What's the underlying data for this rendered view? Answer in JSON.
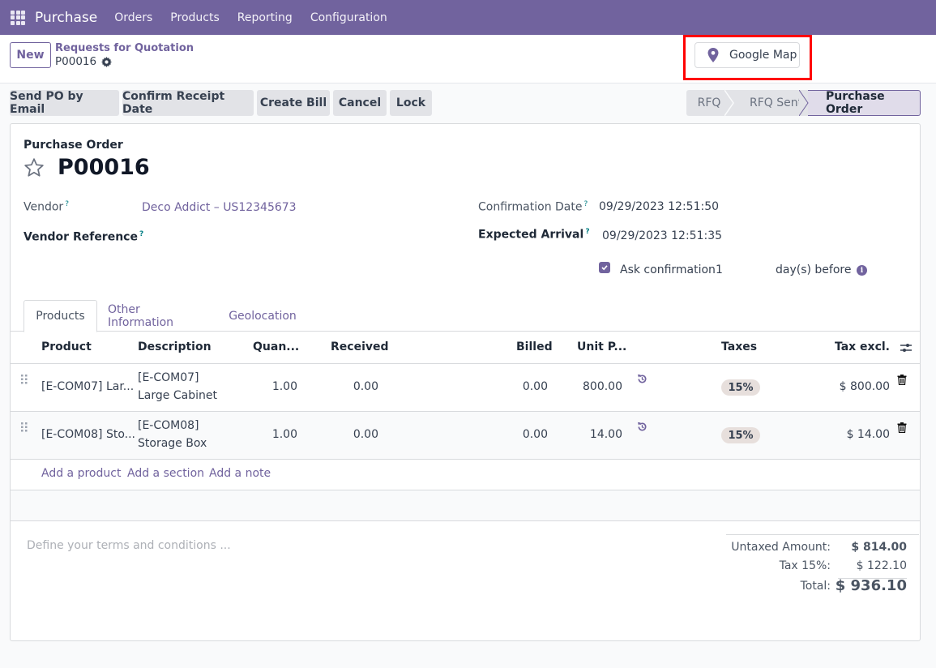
{
  "navbar": {
    "app_name": "Purchase",
    "menu": [
      "Orders",
      "Products",
      "Reporting",
      "Configuration"
    ],
    "apps_icon": "grid-icon"
  },
  "control_panel": {
    "new_label": "New",
    "breadcrumb_parent": "Requests for Quotation",
    "breadcrumb_current": "P00016",
    "settings_icon": "gear-icon",
    "map_button": {
      "label": "Google Map",
      "icon": "map-pin-icon"
    }
  },
  "actions": [
    "Send PO by Email",
    "Confirm Receipt Date",
    "Create Bill",
    "Cancel",
    "Lock"
  ],
  "stages": {
    "items": [
      "RFQ",
      "RFQ Sent",
      "Purchase Order"
    ],
    "current": "Purchase Order"
  },
  "form": {
    "record_type": "Purchase Order",
    "name": "P00016",
    "favorite_icon": "star-icon",
    "vendor": {
      "label": "Vendor",
      "help": "?",
      "value": "Deco Addict – US12345673"
    },
    "vendor_reference": {
      "label": "Vendor Reference",
      "help": "?",
      "value": ""
    },
    "confirmation_date": {
      "label": "Confirmation Date",
      "help": "?",
      "value": "09/29/2023 12:51:50"
    },
    "expected_arrival": {
      "label": "Expected Arrival",
      "help": "?",
      "value": "09/29/2023 12:51:35"
    },
    "ask_confirmation": {
      "label": "Ask confirmation",
      "checked": true,
      "days": "1",
      "suffix": "day(s) before",
      "info_icon": "i"
    }
  },
  "tabs": [
    "Products",
    "Other Information",
    "Geolocation"
  ],
  "active_tab": "Products",
  "lines": {
    "columns": [
      "Product",
      "Description",
      "Quan...",
      "Received",
      "Billed",
      "Unit P...",
      "Taxes",
      "Tax excl."
    ],
    "rows": [
      {
        "product": "[E-COM07] Lar...",
        "desc_code": "[E-COM07]",
        "desc_name": "Large Cabinet",
        "quantity": "1.00",
        "received": "0.00",
        "billed": "0.00",
        "unit_price": "800.00",
        "tax": "15%",
        "subtotal": "$ 800.00"
      },
      {
        "product": "[E-COM08] Sto...",
        "desc_code": "[E-COM08]",
        "desc_name": "Storage Box",
        "quantity": "1.00",
        "received": "0.00",
        "billed": "0.00",
        "unit_price": "14.00",
        "tax": "15%",
        "subtotal": "$ 14.00"
      }
    ],
    "add_links": [
      "Add a product",
      "Add a section",
      "Add a note"
    ]
  },
  "footer": {
    "terms_placeholder": "Define your terms and conditions ...",
    "totals": {
      "untaxed_label": "Untaxed Amount:",
      "untaxed_value": "$ 814.00",
      "tax_label": "Tax 15%:",
      "tax_value": "$ 122.10",
      "total_label": "Total:",
      "total_value": "$ 936.10"
    }
  }
}
